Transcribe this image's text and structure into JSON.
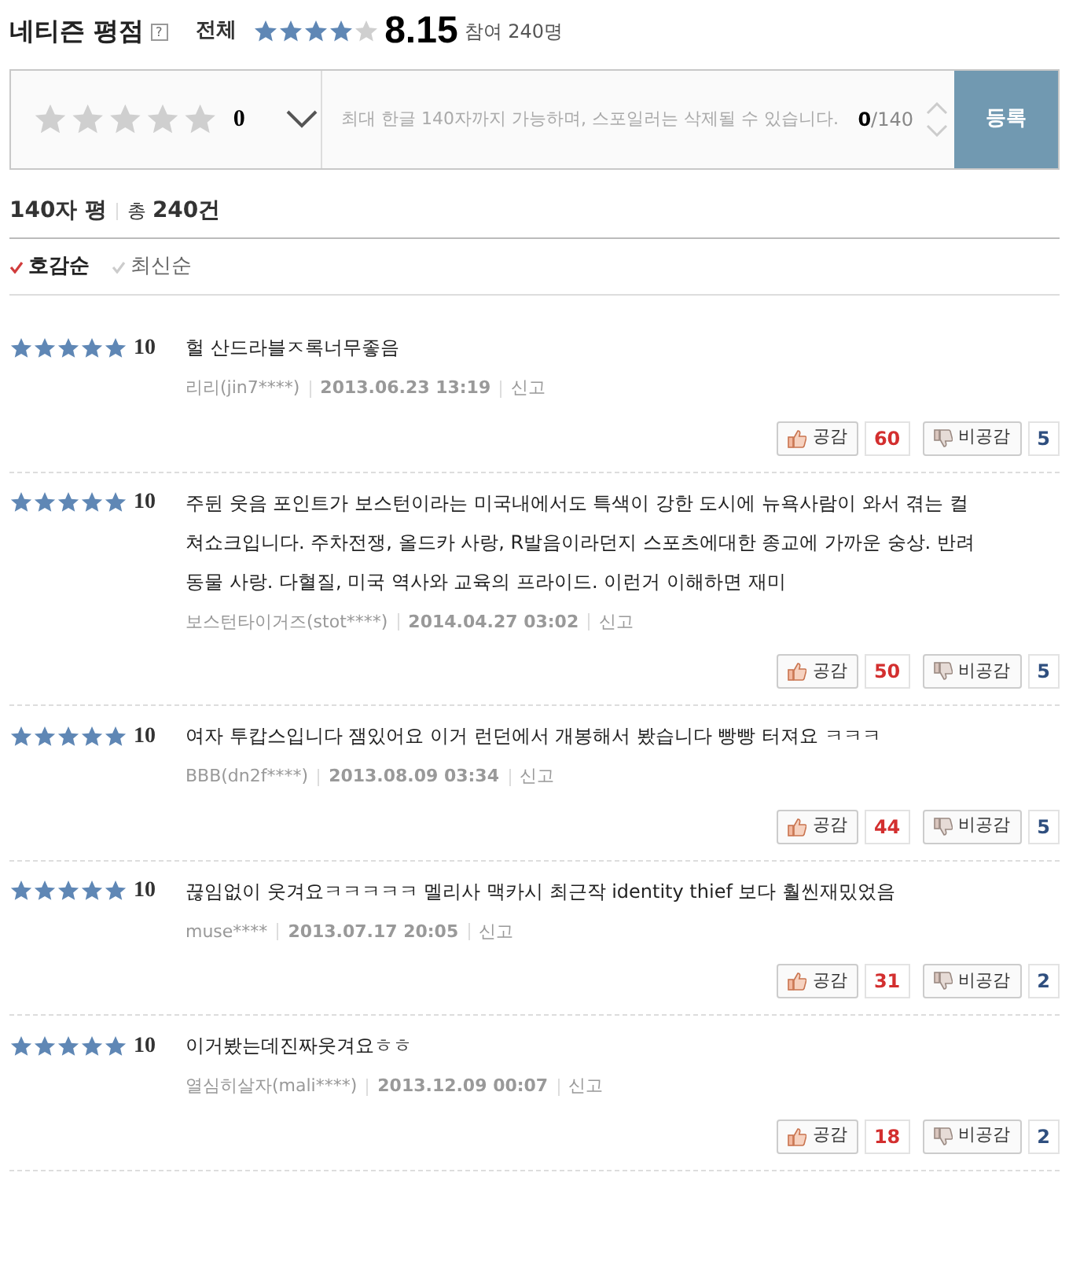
{
  "header": {
    "title": "네티즌 평점",
    "help": "?",
    "scope": "전체",
    "stars": 4,
    "score": "8.15",
    "participants": "참여 240명"
  },
  "composer": {
    "stars": 0,
    "score": "0",
    "placeholder": "최대 한글 140자까지 가능하며, 스포일러는 삭제될 수 있습니다.",
    "count": "0",
    "limit": "/140",
    "submit": "등록"
  },
  "summary": {
    "label": "140자 평",
    "total_prefix": "총",
    "total": "240건"
  },
  "sort_tabs": [
    {
      "label": "호감순",
      "selected": true
    },
    {
      "label": "최신순",
      "selected": false
    }
  ],
  "reviews": [
    {
      "stars": 5,
      "score": "10",
      "text": "헐 산드라블ㅈ록너무좋음",
      "author": "리리(jin7****)",
      "date": "2013.06.23 13:19",
      "report": "신고",
      "like": "공감",
      "likes": "60",
      "dislike": "비공감",
      "dislikes": "5"
    },
    {
      "stars": 5,
      "score": "10",
      "text": "주뒨 웃음 포인트가 보스턴이라는 미국내에서도 특색이 강한 도시에 뉴욕사람이 와서 겪는 컬쳐쇼크입니다. 주차전쟁, 올드카 사랑, R발음이라던지 스포츠에대한 종교에 가까운 숭상. 반려동물 사랑. 다혈질, 미국 역사와 교육의 프라이드. 이런거 이해하면 재미",
      "author": "보스턴타이거즈(stot****)",
      "date": "2014.04.27 03:02",
      "report": "신고",
      "like": "공감",
      "likes": "50",
      "dislike": "비공감",
      "dislikes": "5"
    },
    {
      "stars": 5,
      "score": "10",
      "text": "여자 투캅스입니다 잼있어요 이거 런던에서 개봉해서 봤습니다 빵빵 터져요 ㅋㅋㅋ",
      "author": "BBB(dn2f****)",
      "date": "2013.08.09 03:34",
      "report": "신고",
      "like": "공감",
      "likes": "44",
      "dislike": "비공감",
      "dislikes": "5"
    },
    {
      "stars": 5,
      "score": "10",
      "text": "끊임없이 웃겨요ㅋㅋㅋㅋㅋ 멜리사 맥카시 최근작 identity thief 보다 훨씬재밌었음",
      "author": "muse****",
      "date": "2013.07.17 20:05",
      "report": "신고",
      "like": "공감",
      "likes": "31",
      "dislike": "비공감",
      "dislikes": "2"
    },
    {
      "stars": 5,
      "score": "10",
      "text": "이거봤는데진짜웃겨요ㅎㅎ",
      "author": "열심히살자(mali****)",
      "date": "2013.12.09 00:07",
      "report": "신고",
      "like": "공감",
      "likes": "18",
      "dislike": "비공감",
      "dislikes": "2"
    }
  ]
}
